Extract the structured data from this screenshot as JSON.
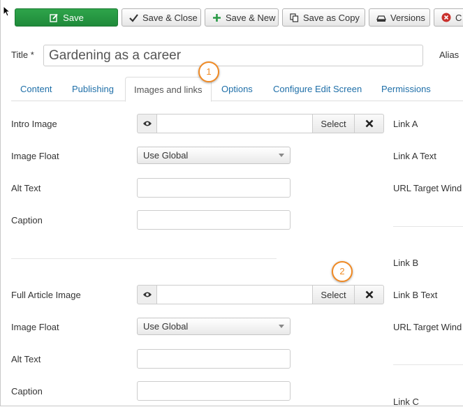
{
  "toolbar": {
    "buttons": [
      {
        "id": "save",
        "label": "Save",
        "icon": "edit-icon"
      },
      {
        "id": "save-close",
        "label": "Save & Close",
        "icon": "check-icon"
      },
      {
        "id": "save-new",
        "label": "Save & New",
        "icon": "plus-icon"
      },
      {
        "id": "save-copy",
        "label": "Save as Copy",
        "icon": "copy-icon"
      },
      {
        "id": "versions",
        "label": "Versions",
        "icon": "versions-icon"
      },
      {
        "id": "close",
        "label": "C",
        "icon": "close-circle-icon"
      }
    ]
  },
  "title_field": {
    "label": "Title *",
    "value": "Gardening as a career"
  },
  "alias_label": "Alias",
  "tabs": [
    {
      "label": "Content",
      "active": false
    },
    {
      "label": "Publishing",
      "active": false
    },
    {
      "label": "Images and links",
      "active": true
    },
    {
      "label": "Options",
      "active": false
    },
    {
      "label": "Configure Edit Screen",
      "active": false
    },
    {
      "label": "Permissions",
      "active": false
    }
  ],
  "callouts": [
    "1",
    "2"
  ],
  "images": {
    "intro": {
      "image_label": "Intro Image",
      "image_value": "",
      "select_label": "Select",
      "float_label": "Image Float",
      "float_value": "Use Global",
      "alt_label": "Alt Text",
      "alt_value": "",
      "caption_label": "Caption",
      "caption_value": ""
    },
    "full": {
      "image_label": "Full Article Image",
      "image_value": "",
      "select_label": "Select",
      "float_label": "Image Float",
      "float_value": "Use Global",
      "alt_label": "Alt Text",
      "alt_value": "",
      "caption_label": "Caption",
      "caption_value": ""
    }
  },
  "links": {
    "a_label": "Link A",
    "a_text_label": "Link A Text",
    "a_target_label": "URL Target Wind",
    "b_label": "Link B",
    "b_text_label": "Link B Text",
    "b_target_label": "URL Target Wind",
    "c_label": "Link C"
  }
}
